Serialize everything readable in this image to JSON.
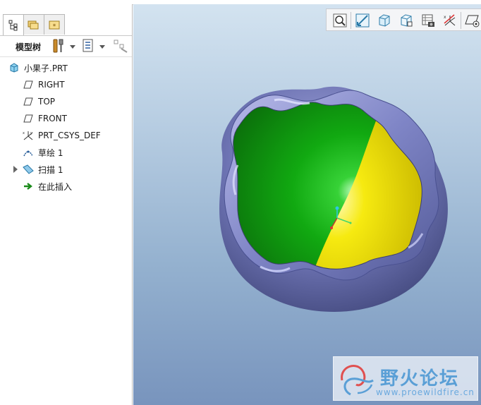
{
  "model_tree": {
    "label": "模型树",
    "tabs": [
      {
        "name": "tab-model-tree"
      },
      {
        "name": "tab-layers"
      },
      {
        "name": "tab-favorites"
      }
    ],
    "items": [
      {
        "label": "小果子.PRT",
        "icon": "part-icon"
      },
      {
        "label": "RIGHT",
        "icon": "datum-plane-icon"
      },
      {
        "label": "TOP",
        "icon": "datum-plane-icon"
      },
      {
        "label": "FRONT",
        "icon": "datum-plane-icon"
      },
      {
        "label": "PRT_CSYS_DEF",
        "icon": "coordinate-system-icon"
      },
      {
        "label": "草绘 1",
        "icon": "sketch-icon"
      },
      {
        "label": "扫描 1",
        "icon": "sweep-icon",
        "expandable": true
      },
      {
        "label": "在此插入",
        "icon": "insert-here-arrow-icon"
      }
    ]
  },
  "view_toolbar": {
    "buttons": [
      "refit-icon",
      "zoom-area-icon",
      "display-style-icon",
      "saved-orientations-icon",
      "view-manager-icon",
      "datum-display-icon",
      "spin-center-icon"
    ]
  },
  "watermark": {
    "title": "野火论坛",
    "url": "www.proewildfire.cn"
  },
  "colors": {
    "shell": "#6f75b6",
    "inner_green": "#0fa20f",
    "inner_yellow": "#f0e400",
    "viewport_top": "#d3e3f0",
    "viewport_bottom": "#7894bd"
  }
}
